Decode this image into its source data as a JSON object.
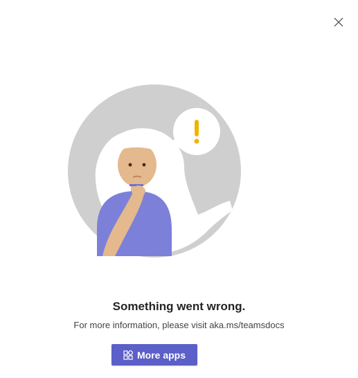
{
  "dialog": {
    "close_icon": "close-icon",
    "illustration": "confused-woman-illustration"
  },
  "error": {
    "title": "Something went wrong.",
    "message": "For more information, please visit aka.ms/teamsdocs"
  },
  "actions": {
    "more_apps_label": "More apps",
    "more_apps_icon": "apps-icon"
  },
  "colors": {
    "accent": "#5b5fc7",
    "alert": "#f0b400",
    "circle": "#cfcfcf"
  }
}
